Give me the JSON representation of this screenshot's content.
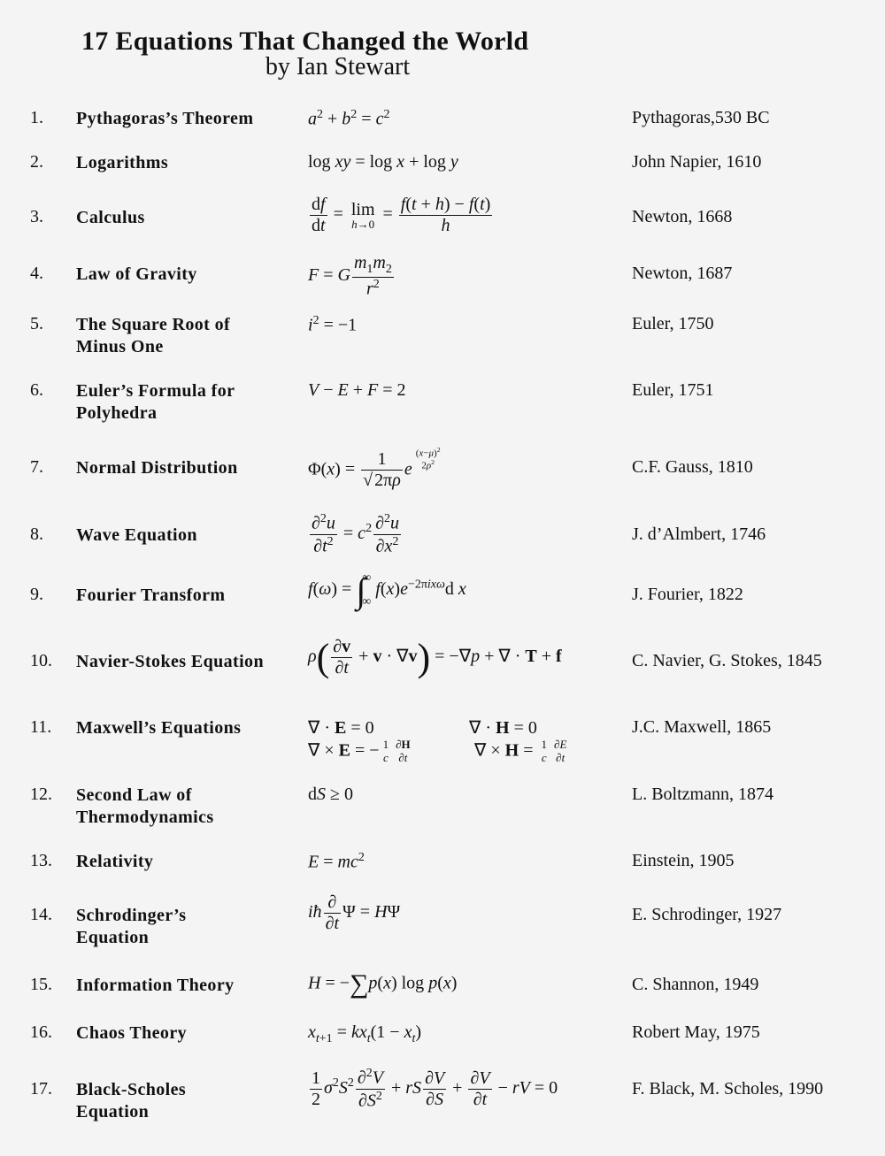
{
  "header": {
    "title": "17 Equations That Changed the World",
    "subtitle": "by Ian Stewart"
  },
  "equations": [
    {
      "num": "1.",
      "name": "Pythagoras’s Theorem",
      "formula": "a^2 + b^2 = c^2",
      "who": "Pythagoras,530 BC"
    },
    {
      "num": "2.",
      "name": "Logarithms",
      "formula": "log xy = log x + log y",
      "who": "John Napier, 1610"
    },
    {
      "num": "3.",
      "name": "Calculus",
      "formula": "df/dt = lim_{h→0} (f(t+h) − f(t))/h",
      "who": "Newton, 1668"
    },
    {
      "num": "4.",
      "name": "Law of Gravity",
      "formula": "F = G m1 m2 / r^2",
      "who": "Newton, 1687"
    },
    {
      "num": "5.",
      "name": "The Square Root of Minus One",
      "formula": "i^2 = −1",
      "who": "Euler, 1750"
    },
    {
      "num": "6.",
      "name": "Euler’s Formula for Polyhedra",
      "formula": "V − E + F = 2",
      "who": "Euler, 1751"
    },
    {
      "num": "7.",
      "name": "Normal Distribution",
      "formula": "Φ(x) = 1/√(2πρ) e^{(x−μ)^2 / 2ρ^2}",
      "who": "C.F. Gauss, 1810"
    },
    {
      "num": "8.",
      "name": "Wave Equation",
      "formula": "∂²u/∂t² = c² ∂²u/∂x²",
      "who": "J. d’Almbert, 1746"
    },
    {
      "num": "9.",
      "name": "Fourier Transform",
      "formula": "f(ω) = ∫_∞^∞ f(x) e^{−2πixω} dx",
      "who": "J. Fourier, 1822"
    },
    {
      "num": "10.",
      "name": "Navier-Stokes Equation",
      "formula": "ρ(∂v/∂t + v·∇v) = −∇p + ∇·T + f",
      "who": "C. Navier, G. Stokes, 1845"
    },
    {
      "num": "11.",
      "name": "Maxwell’s Equations",
      "formula": "∇·E = 0; ∇·H = 0; ∇×E = −(1/c) ∂H/∂t; ∇×H = (1/c) ∂E/∂t",
      "who": "J.C. Maxwell, 1865"
    },
    {
      "num": "12.",
      "name": "Second Law of Thermodynamics",
      "formula": "dS ≥ 0",
      "who": "L. Boltzmann, 1874"
    },
    {
      "num": "13.",
      "name": "Relativity",
      "formula": "E = mc^2",
      "who": "Einstein, 1905"
    },
    {
      "num": "14.",
      "name": "Schrodinger’s Equation",
      "formula": "iħ ∂/∂t Ψ = HΨ",
      "who": "E. Schrodinger, 1927"
    },
    {
      "num": "15.",
      "name": "Information Theory",
      "formula": "H = −Σ p(x) log p(x)",
      "who": "C. Shannon, 1949"
    },
    {
      "num": "16.",
      "name": "Chaos Theory",
      "formula": "x_{t+1} = k x_t (1 − x_t)",
      "who": "Robert May, 1975"
    },
    {
      "num": "17.",
      "name": "Black-Scholes Equation",
      "formula": "½σ²S² ∂²V/∂S² + rS ∂V/∂S + ∂V/∂t − rV = 0",
      "who": "F. Black, M. Scholes, 1990"
    }
  ]
}
